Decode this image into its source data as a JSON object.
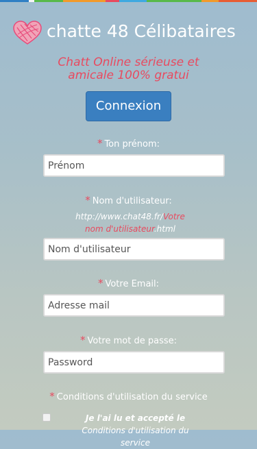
{
  "colors": {
    "accent": "#e84a5f",
    "button_bg": "#3a7fc0",
    "topbar": [
      "#2f7fc4",
      "#f5f5f5",
      "#58b94a",
      "#f29a2b",
      "#e84a5f",
      "#3fa9e0",
      "#58b94a",
      "#f29a2b",
      "#e85d34"
    ]
  },
  "header": {
    "logo_icon": "heart-icon",
    "title": "chatte 48 Célibataires"
  },
  "tagline": "Chatt Online sérieuse et amicale 100% gratui",
  "login_button": "Connexion",
  "form": {
    "required_mark": "*",
    "firstname": {
      "label": "Ton prénom:",
      "placeholder": "Prénom"
    },
    "username": {
      "label": "Nom d'utilisateur:",
      "hint_prefix": "http://www.chat48.fr/",
      "hint_user": "Votre nom d'utilisateur",
      "hint_suffix": ".html",
      "placeholder": "Nom d'utilisateur"
    },
    "email": {
      "label": "Votre Email:",
      "placeholder": "Adresse mail"
    },
    "password": {
      "label": "Votre mot de passe:",
      "placeholder": "Password"
    },
    "terms": {
      "label": "Conditions d'utilisation du service",
      "checkbox_text": "Je l'ai lu et accepté le",
      "link_text": "Conditions d'utilisation du service"
    }
  }
}
